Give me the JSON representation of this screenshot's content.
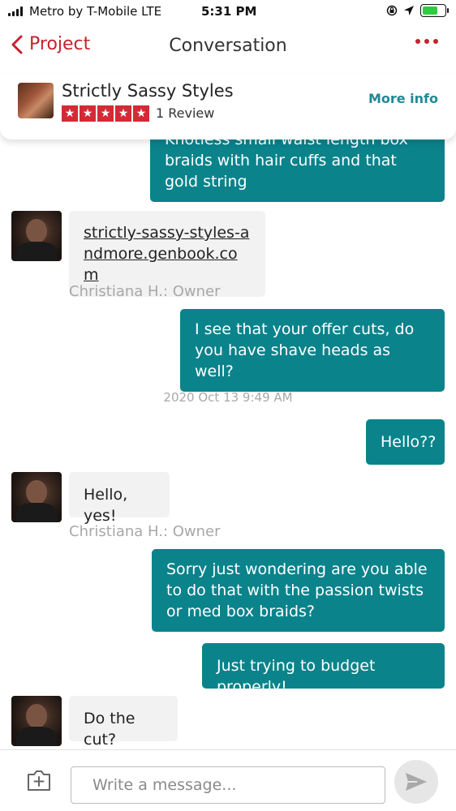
{
  "status_bar": {
    "carrier": "Metro by T-Mobile  LTE",
    "time": "5:31 PM",
    "battery_level": 0.75,
    "battery_color": "#2ecc40"
  },
  "nav": {
    "back_label": "Project",
    "title": "Conversation",
    "accent_color": "#c8202c"
  },
  "business": {
    "name": "Strictly Sassy Styles",
    "rating": 5,
    "review_count": "1 Review",
    "more_info_label": "More info"
  },
  "messages": [
    {
      "type": "outgoing",
      "text": "Knotless small  waist length box braids with hair cuffs and that gold string"
    },
    {
      "type": "incoming",
      "text": "strictly-sassy-styles-andmore.genbook.com",
      "is_link": true,
      "sender": "Christiana H.: Owner"
    },
    {
      "type": "outgoing",
      "text": "I see that your offer cuts, do you have shave heads as well?"
    },
    {
      "type": "timestamp",
      "text": "2020 Oct 13 9:49 AM"
    },
    {
      "type": "outgoing",
      "text": "Hello??"
    },
    {
      "type": "incoming",
      "text": "Hello, yes!",
      "sender": "Christiana H.: Owner"
    },
    {
      "type": "outgoing",
      "text": "Sorry just wondering are you able to do that with the passion twists or med box braids?"
    },
    {
      "type": "outgoing",
      "text": "Just trying to budget properly!"
    },
    {
      "type": "incoming",
      "text": "Do the cut?"
    }
  ],
  "composer": {
    "placeholder": "Write a message...",
    "bubble_color": "#0a838b"
  },
  "icons": {
    "signal": "signal-bars-icon",
    "location": "location-arrow-icon",
    "rotation_lock": "rotation-lock-icon",
    "battery": "battery-icon",
    "back": "chevron-left-icon",
    "more": "more-dots-icon",
    "attach": "camera-plus-icon",
    "send": "send-icon"
  }
}
